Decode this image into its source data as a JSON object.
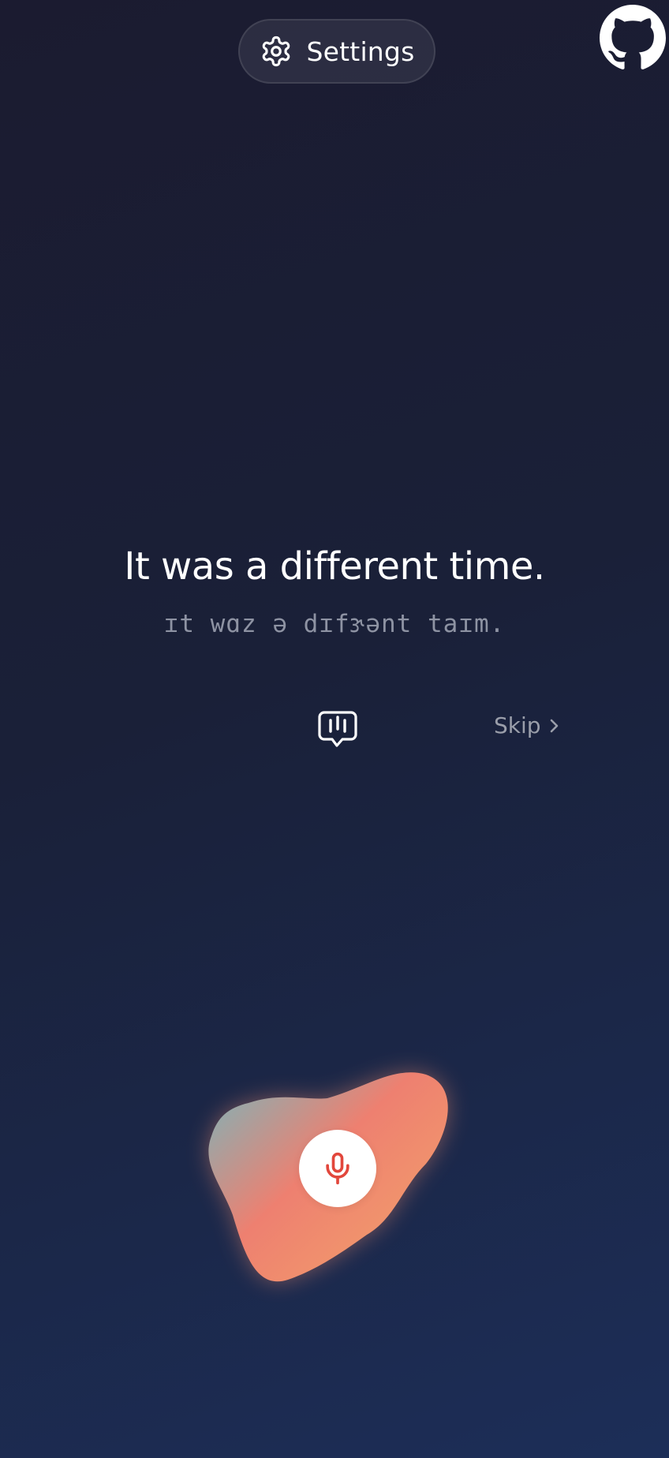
{
  "header": {
    "settings_label": "Settings",
    "settings_icon": "gear-icon",
    "github_icon": "github-icon"
  },
  "practice": {
    "sentence": "It was a different time.",
    "ipa": "ɪt wɑz ə dɪfɝənt taɪm.",
    "listen_icon": "speech-bubble-audio-icon",
    "skip_label": "Skip",
    "skip_icon": "chevron-right-icon"
  },
  "recorder": {
    "mic_icon": "microphone-icon"
  },
  "colors": {
    "background_top": "#1b1b30",
    "background_bottom": "#1c2e58",
    "blob_teal": "#7fb3b8",
    "blob_coral": "#ee8070",
    "blob_orange": "#f1976c",
    "mic_red": "#e2473c",
    "muted_text": "#8e93a3"
  }
}
